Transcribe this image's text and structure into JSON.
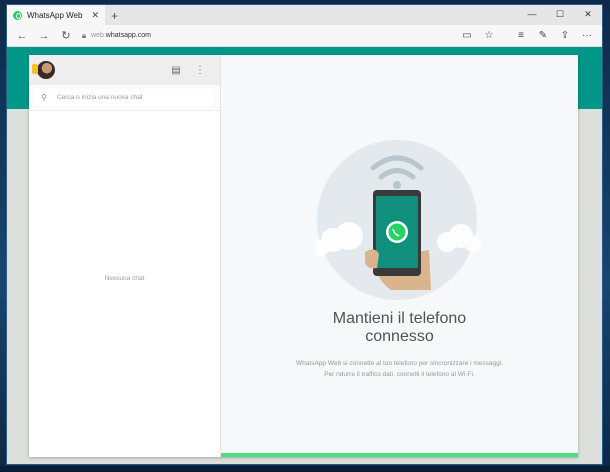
{
  "browser": {
    "tab_title": "WhatsApp Web",
    "tab_close": "✕",
    "new_tab": "+",
    "url_prefix": "web.",
    "url_domain": "whatsapp.com",
    "window_controls": [
      "—",
      "☐",
      "✕"
    ]
  },
  "sidebar": {
    "search_placeholder": "Cerca o inizia una nuova chat",
    "empty_text": "Nessuna chat"
  },
  "main": {
    "headline_line1": "Mantieni il telefono",
    "headline_line2": "connesso",
    "desc_line1": "WhatsApp Web si connette al tuo telefono per sincronizzare i messaggi.",
    "desc_line2": "Per ridurre il traffico dati, connetti il telefono al Wi-Fi."
  },
  "colors": {
    "brand_teal": "#009688",
    "whatsapp_green": "#25d366",
    "progress_green": "#4adf83"
  }
}
